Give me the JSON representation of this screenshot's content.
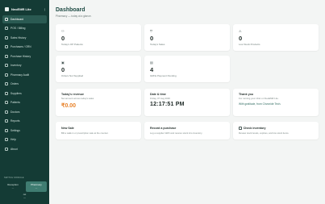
{
  "app": {
    "name": "NeoEMR Lite",
    "toggle_icon": "sidebar-toggle-icon"
  },
  "sidebar": {
    "items": [
      {
        "label": "Dashboard",
        "icon": "dashboard-icon",
        "active": true
      },
      {
        "label": "POS / Billing",
        "icon": "pos-icon"
      },
      {
        "label": "Sales History",
        "icon": "history-icon"
      },
      {
        "label": "Purchases / GRN",
        "icon": "purchase-icon"
      },
      {
        "label": "Purchase History",
        "icon": "purchase-history-icon"
      },
      {
        "label": "Inventory",
        "icon": "inventory-icon"
      },
      {
        "label": "Pharmacy Audit",
        "icon": "audit-icon"
      },
      {
        "label": "Orders",
        "icon": "orders-icon"
      },
      {
        "label": "Suppliers",
        "icon": "suppliers-icon"
      },
      {
        "label": "Patients",
        "icon": "patients-icon"
      },
      {
        "label": "Doctors",
        "icon": "doctors-icon"
      },
      {
        "label": "Reports",
        "icon": "reports-icon"
      },
      {
        "label": "Settings",
        "icon": "settings-icon"
      },
      {
        "label": "Help",
        "icon": "help-icon"
      },
      {
        "label": "About",
        "icon": "about-icon"
      }
    ],
    "mode_label": "SWITCH MODULE",
    "modes": [
      {
        "label": "Reception",
        "sub": "—"
      },
      {
        "label": "Pharmacy",
        "sub": "—",
        "active": true
      }
    ],
    "user": {
      "line1": "cet",
      "line2": "—"
    }
  },
  "header": {
    "title": "Dashboard",
    "breadcrumb": "Pharmacy — today at a glance."
  },
  "stats": [
    {
      "value": "0",
      "label": "Today's OP Patients",
      "icon": "users-icon"
    },
    {
      "value": "0",
      "label": "Today's Sales",
      "icon": "cart-icon"
    },
    {
      "value": "0",
      "label": "Low Stock Products",
      "icon": "warning-icon"
    },
    {
      "value": "0",
      "label": "Orders Not Supplied",
      "icon": "box-icon"
    },
    {
      "value": "4",
      "label": "GRNs Payment Pending",
      "icon": "invoice-icon"
    }
  ],
  "revenue_card": {
    "title": "Today's revenue",
    "subtitle": "Net amount across today's sales",
    "value": "₹0.00"
  },
  "datetime_card": {
    "title": "Date & time",
    "date": "Friday, 07 Aug 2026",
    "time": "12:17:51 PM"
  },
  "thanks_card": {
    "title": "Thank you",
    "subtitle": "For running your clinic on NeoEMR Lite.",
    "line": "With gratitude, from Chvonide Tech."
  },
  "actions": [
    {
      "title": "New Sale",
      "desc": "Bill a walk-in or prescription sale at the counter."
    },
    {
      "title": "Record a purchase",
      "desc": "Log a supplier GRN and receive stock into inventory."
    },
    {
      "title": "Check inventory",
      "desc": "Review stock levels, expiries, and low stock items.",
      "icon": "inventory-check-icon"
    }
  ],
  "colors": {
    "sidebar": "#143b35",
    "accent": "#e8822a",
    "title": "#1d4a43"
  }
}
